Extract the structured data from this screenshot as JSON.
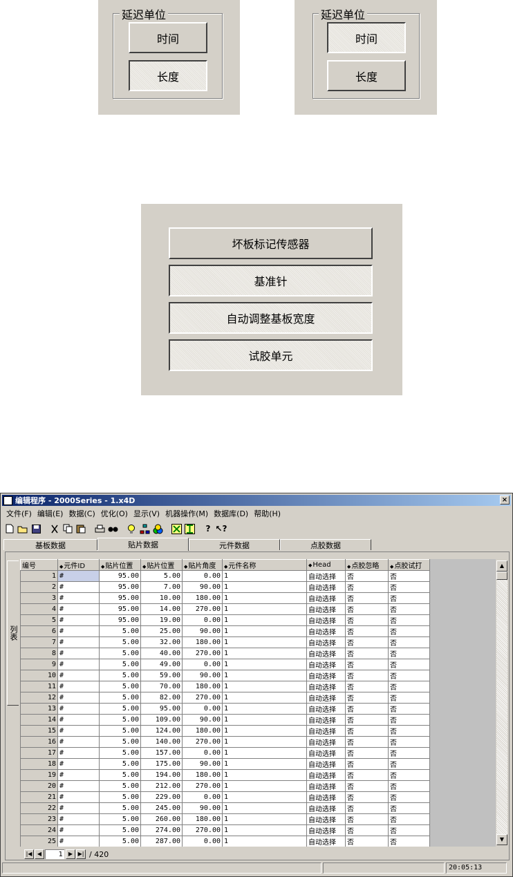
{
  "delay_unit_panels": [
    {
      "legend": "延迟单位",
      "time_label": "时间",
      "length_label": "长度",
      "pressed": "length"
    },
    {
      "legend": "延迟单位",
      "time_label": "时间",
      "length_label": "长度",
      "pressed": "time"
    }
  ],
  "sensor_panel": {
    "buttons": [
      "坏板标记传感器",
      "基准针",
      "自动调整基板宽度",
      "试胶单元"
    ]
  },
  "window": {
    "title": "编辑程序 - 2000Series - 1.x4D",
    "close_glyph": "×",
    "menu": [
      "文件(F)",
      "编辑(E)",
      "数据(C)",
      "优化(O)",
      "显示(V)",
      "机器操作(M)",
      "数据库(D)",
      "帮助(H)"
    ],
    "toolbar_icons": [
      "new-file-icon",
      "open-folder-icon",
      "save-icon",
      "cut-icon",
      "copy-icon",
      "paste-icon",
      "print-icon",
      "binoculars-icon",
      "lightbulb-icon",
      "network-icon",
      "palette-icon",
      "zoom-fit-icon",
      "zoom-height-icon",
      "help-icon",
      "context-help-icon"
    ],
    "tabs": [
      "基板数据",
      "贴片数据",
      "元件数据",
      "点胶数据"
    ],
    "active_tab": 1,
    "side_tab_label": "列表",
    "columns": [
      "编号",
      "元件ID",
      "贴片位置",
      "贴片位置",
      "贴片角度",
      "元件名称",
      "Head",
      "点胶忽略",
      "点胶试打"
    ],
    "rows": [
      [
        "1",
        "#",
        "95.00",
        "5.00",
        "0.00",
        "1",
        "自动选择",
        "否",
        "否"
      ],
      [
        "2",
        "#",
        "95.00",
        "7.00",
        "90.00",
        "1",
        "自动选择",
        "否",
        "否"
      ],
      [
        "3",
        "#",
        "95.00",
        "10.00",
        "180.00",
        "1",
        "自动选择",
        "否",
        "否"
      ],
      [
        "4",
        "#",
        "95.00",
        "14.00",
        "270.00",
        "1",
        "自动选择",
        "否",
        "否"
      ],
      [
        "5",
        "#",
        "95.00",
        "19.00",
        "0.00",
        "1",
        "自动选择",
        "否",
        "否"
      ],
      [
        "6",
        "#",
        "5.00",
        "25.00",
        "90.00",
        "1",
        "自动选择",
        "否",
        "否"
      ],
      [
        "7",
        "#",
        "5.00",
        "32.00",
        "180.00",
        "1",
        "自动选择",
        "否",
        "否"
      ],
      [
        "8",
        "#",
        "5.00",
        "40.00",
        "270.00",
        "1",
        "自动选择",
        "否",
        "否"
      ],
      [
        "9",
        "#",
        "5.00",
        "49.00",
        "0.00",
        "1",
        "自动选择",
        "否",
        "否"
      ],
      [
        "10",
        "#",
        "5.00",
        "59.00",
        "90.00",
        "1",
        "自动选择",
        "否",
        "否"
      ],
      [
        "11",
        "#",
        "5.00",
        "70.00",
        "180.00",
        "1",
        "自动选择",
        "否",
        "否"
      ],
      [
        "12",
        "#",
        "5.00",
        "82.00",
        "270.00",
        "1",
        "自动选择",
        "否",
        "否"
      ],
      [
        "13",
        "#",
        "5.00",
        "95.00",
        "0.00",
        "1",
        "自动选择",
        "否",
        "否"
      ],
      [
        "14",
        "#",
        "5.00",
        "109.00",
        "90.00",
        "1",
        "自动选择",
        "否",
        "否"
      ],
      [
        "15",
        "#",
        "5.00",
        "124.00",
        "180.00",
        "1",
        "自动选择",
        "否",
        "否"
      ],
      [
        "16",
        "#",
        "5.00",
        "140.00",
        "270.00",
        "1",
        "自动选择",
        "否",
        "否"
      ],
      [
        "17",
        "#",
        "5.00",
        "157.00",
        "0.00",
        "1",
        "自动选择",
        "否",
        "否"
      ],
      [
        "18",
        "#",
        "5.00",
        "175.00",
        "90.00",
        "1",
        "自动选择",
        "否",
        "否"
      ],
      [
        "19",
        "#",
        "5.00",
        "194.00",
        "180.00",
        "1",
        "自动选择",
        "否",
        "否"
      ],
      [
        "20",
        "#",
        "5.00",
        "212.00",
        "270.00",
        "1",
        "自动选择",
        "否",
        "否"
      ],
      [
        "21",
        "#",
        "5.00",
        "229.00",
        "0.00",
        "1",
        "自动选择",
        "否",
        "否"
      ],
      [
        "22",
        "#",
        "5.00",
        "245.00",
        "90.00",
        "1",
        "自动选择",
        "否",
        "否"
      ],
      [
        "23",
        "#",
        "5.00",
        "260.00",
        "180.00",
        "1",
        "自动选择",
        "否",
        "否"
      ],
      [
        "24",
        "#",
        "5.00",
        "274.00",
        "270.00",
        "1",
        "自动选择",
        "否",
        "否"
      ],
      [
        "25",
        "#",
        "5.00",
        "287.00",
        "0.00",
        "1",
        "自动选择",
        "否",
        "否"
      ]
    ],
    "nav": {
      "current": "1",
      "total": "/ 420"
    },
    "status_time": "20:05:13"
  }
}
